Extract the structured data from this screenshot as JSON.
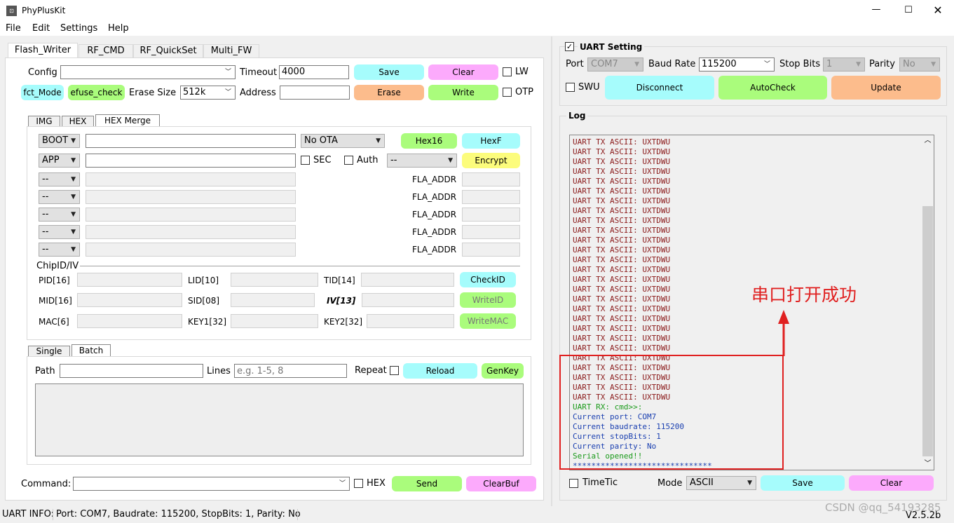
{
  "window": {
    "title": "PhyPlusKit"
  },
  "menu": [
    "File",
    "Edit",
    "Settings",
    "Help"
  ],
  "tabs": [
    "Flash_Writer",
    "RF_CMD",
    "RF_QuickSet",
    "Multi_FW"
  ],
  "flash": {
    "config_label": "Config",
    "config_value": "",
    "timeout_label": "Timeout",
    "timeout_value": "4000",
    "save": "Save",
    "clear": "Clear",
    "lw": "LW",
    "fct_mode": "fct_Mode",
    "efuse_check": "efuse_check",
    "erase_size_label": "Erase Size",
    "erase_size_value": "512k",
    "address_label": "Address",
    "address_value": "",
    "erase": "Erase",
    "write": "Write",
    "otp": "OTP"
  },
  "subtabs": [
    "IMG",
    "HEX",
    "HEX Merge"
  ],
  "merge": {
    "boot": "BOOT",
    "app": "APP",
    "ota": "No OTA",
    "sec": "SEC",
    "auth": "Auth",
    "auth_sel": "--",
    "hex16": "Hex16",
    "hexf": "HexF",
    "encrypt": "Encrypt",
    "rows": [
      {
        "sel": "--",
        "addr": "FLA_ADDR"
      },
      {
        "sel": "--",
        "addr": "FLA_ADDR"
      },
      {
        "sel": "--",
        "addr": "FLA_ADDR"
      },
      {
        "sel": "--",
        "addr": "FLA_ADDR"
      },
      {
        "sel": "--",
        "addr": "FLA_ADDR"
      }
    ]
  },
  "chipid": {
    "title": "ChipID/IV",
    "pid": "PID[16]",
    "lid": "LID[10]",
    "tid": "TID[14]",
    "checkid": "CheckID",
    "mid": "MID[16]",
    "sid": "SID[08]",
    "iv": "IV[13]",
    "writeid": "WriteID",
    "mac": "MAC[6]",
    "key1": "KEY1[32]",
    "key2": "KEY2[32]",
    "writemac": "WriteMAC"
  },
  "batch": {
    "tabs": [
      "Single",
      "Batch"
    ],
    "path_label": "Path",
    "lines_label": "Lines",
    "lines_placeholder": "e.g. 1-5, 8",
    "repeat": "Repeat",
    "reload": "Reload",
    "genkey": "GenKey"
  },
  "command": {
    "label": "Command:",
    "hex": "HEX",
    "send": "Send",
    "clearbuf": "ClearBuf"
  },
  "status": {
    "label": "UART INFO:",
    "info": "Port: COM7, Baudrate: 115200, StopBits: 1, Parity: No",
    "version": "V2.5.2b"
  },
  "uart": {
    "title": "UART Setting",
    "checked": true,
    "port_label": "Port",
    "port": "COM7",
    "baud_label": "Baud Rate",
    "baud": "115200",
    "stop_label": "Stop Bits",
    "stop": "1",
    "parity_label": "Parity",
    "parity": "No",
    "swu": "SWU",
    "disconnect": "Disconnect",
    "autocheck": "AutoCheck",
    "update": "Update"
  },
  "log": {
    "title": "Log",
    "lines": [
      {
        "t": "UART TX ASCII: UXTDWU",
        "c": "#8b1a1a",
        "n": 27
      },
      {
        "t": "UART RX: cmd>>:",
        "c": "#1a9a1a",
        "n": 1
      },
      {
        "t": "Current port: COM7",
        "c": "#1a3fb0",
        "n": 1
      },
      {
        "t": "Current baudrate: 115200",
        "c": "#1a3fb0",
        "n": 1
      },
      {
        "t": "Current stopBits: 1",
        "c": "#1a3fb0",
        "n": 1
      },
      {
        "t": "Current parity: No",
        "c": "#1a3fb0",
        "n": 1
      },
      {
        "t": "Serial opened!!",
        "c": "#1a9a1a",
        "n": 1
      },
      {
        "t": "******************************",
        "c": "#1a3fb0",
        "n": 1
      }
    ],
    "timetic": "TimeTic",
    "mode_label": "Mode",
    "mode": "ASCII",
    "save": "Save",
    "clear": "Clear"
  },
  "annotation": {
    "text": "串口打开成功",
    "color": "#e02020"
  },
  "watermark": "CSDN @qq_54193285",
  "colors": {
    "cyan": "#a6fcfc",
    "pink": "#fcaafc",
    "green": "#aafc7c",
    "orange": "#fcbc8c",
    "yellow": "#fcfc7c"
  }
}
